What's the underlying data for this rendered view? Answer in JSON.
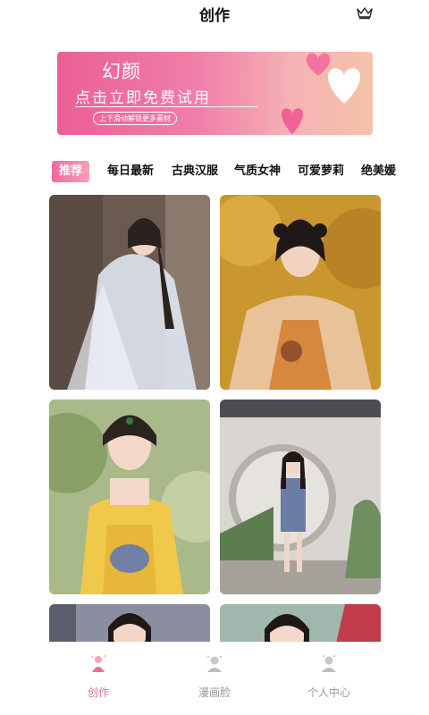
{
  "header": {
    "title": "创作"
  },
  "banner": {
    "title": "幻颜",
    "subtitle": "点击立即免费试用",
    "tag": "上下滑动解锁更多素材"
  },
  "tabs": [
    "推荐",
    "每日最新",
    "古典汉服",
    "气质女神",
    "可爱萝莉",
    "绝美媛"
  ],
  "bottom_nav": {
    "items": [
      {
        "label": "创作",
        "icon": "create-icon"
      },
      {
        "label": "漫画脸",
        "icon": "comic-face-icon"
      },
      {
        "label": "个人中心",
        "icon": "profile-icon"
      }
    ]
  },
  "colors": {
    "accent": "#f06a9c",
    "banner_start": "#ec5f96",
    "banner_end": "#f4c3a8"
  }
}
